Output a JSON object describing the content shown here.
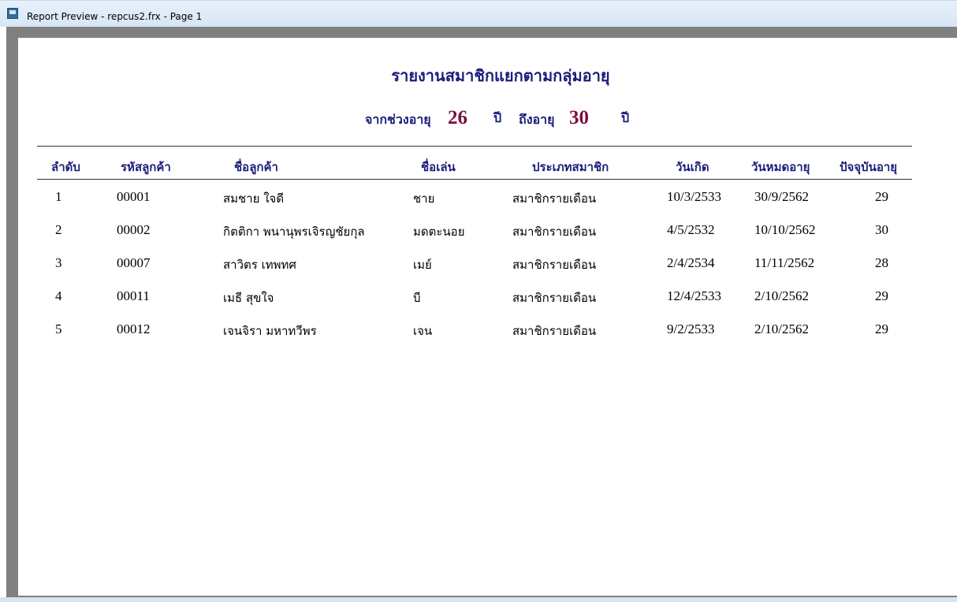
{
  "window": {
    "title": "Report Preview - repcus2.frx - Page 1",
    "icon": "report-preview-icon"
  },
  "report": {
    "title": "รายงานสมาชิกแยกตามกลุ่มอายุ",
    "range": {
      "from_label": "จากช่วงอายุ",
      "from_value": "26",
      "from_unit": "ปี",
      "to_label": "ถึงอายุ",
      "to_value": "30",
      "to_unit": "ปี"
    },
    "columns": [
      "ลำดับ",
      "รหัสลูกค้า",
      "ชื่อลูกค้า",
      "ชื่อเล่น",
      "ประเภทสมาชิก",
      "วันเกิด",
      "วันหมดอายุ",
      "ปัจจุบันอายุ"
    ],
    "rows": [
      [
        "1",
        "00001",
        "สมชาย ใจดี",
        "ชาย",
        "สมาชิกรายเดือน",
        "10/3/2533",
        "30/9/2562",
        "29"
      ],
      [
        "2",
        "00002",
        "กิตติกา พนานุพรเจิรญชัยกุล",
        "มดตะนอย",
        "สมาชิกรายเดือน",
        "4/5/2532",
        "10/10/2562",
        "30"
      ],
      [
        "3",
        "00007",
        "สาวิตร เทพทศ",
        "เมย์",
        "สมาชิกรายเดือน",
        "2/4/2534",
        "11/11/2562",
        "28"
      ],
      [
        "4",
        "00011",
        "เมธี สุขใจ",
        "บี",
        "สมาชิกรายเดือน",
        "12/4/2533",
        "2/10/2562",
        "29"
      ],
      [
        "5",
        "00012",
        "เจนจิรา มหาทวีพร",
        "เจน",
        "สมาชิกรายเดือน",
        "9/2/2533",
        "2/10/2562",
        "29"
      ]
    ]
  }
}
